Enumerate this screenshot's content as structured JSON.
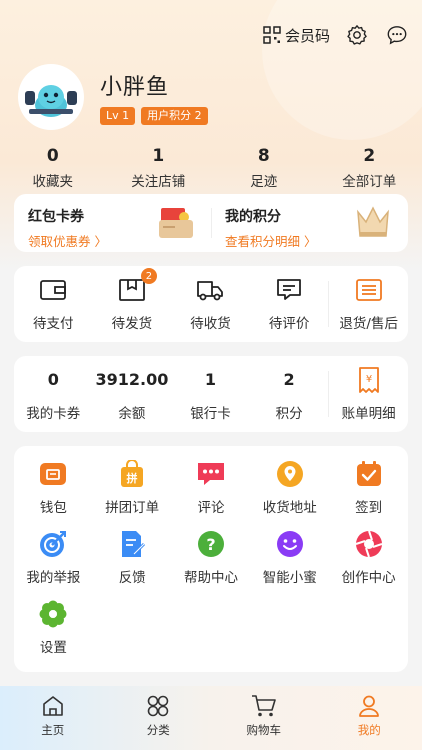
{
  "header": {
    "member_code": "会员码"
  },
  "profile": {
    "username": "小胖鱼",
    "level": "Lv 1",
    "points_badge": "用户积分 2"
  },
  "stats": [
    {
      "value": "0",
      "label": "收藏夹"
    },
    {
      "value": "1",
      "label": "关注店铺"
    },
    {
      "value": "8",
      "label": "足迹"
    },
    {
      "value": "2",
      "label": "全部订单"
    }
  ],
  "promo": {
    "left": {
      "title": "红包卡券",
      "link": "领取优惠券 〉"
    },
    "right": {
      "title": "我的积分",
      "link": "查看积分明细 〉"
    }
  },
  "orders": [
    {
      "label": "待支付",
      "icon": "wallet-icon"
    },
    {
      "label": "待发货",
      "icon": "package-icon",
      "badge": "2"
    },
    {
      "label": "待收货",
      "icon": "truck-icon"
    },
    {
      "label": "待评价",
      "icon": "comment-icon"
    },
    {
      "label": "退货/售后",
      "icon": "refund-icon"
    }
  ],
  "wallet": [
    {
      "value": "0",
      "label": "我的卡券"
    },
    {
      "value": "3912.00",
      "label": "余额"
    },
    {
      "value": "1",
      "label": "银行卡"
    },
    {
      "value": "2",
      "label": "积分"
    },
    {
      "label": "账单明细",
      "icon": "bill-icon"
    }
  ],
  "tools": [
    {
      "label": "钱包",
      "icon": "wallet-orange-icon",
      "color": "#f07a22"
    },
    {
      "label": "拼团订单",
      "icon": "group-bag-icon",
      "color": "#f5a623"
    },
    {
      "label": "评论",
      "icon": "chat-icon",
      "color": "#ef3b57"
    },
    {
      "label": "收货地址",
      "icon": "location-icon",
      "color": "#f5a623"
    },
    {
      "label": "签到",
      "icon": "calendar-check-icon",
      "color": "#f07a22"
    },
    {
      "label": "我的举报",
      "icon": "target-icon",
      "color": "#3b8cf5"
    },
    {
      "label": "反馈",
      "icon": "feedback-icon",
      "color": "#3b8cf5"
    },
    {
      "label": "帮助中心",
      "icon": "help-icon",
      "color": "#4caf3b"
    },
    {
      "label": "智能小蜜",
      "icon": "smile-icon",
      "color": "#8a3bf5"
    },
    {
      "label": "创作中心",
      "icon": "aperture-icon",
      "color": "#ef3b57"
    },
    {
      "label": "设置",
      "icon": "gear-flower-icon",
      "color": "#5cb531"
    }
  ],
  "tabbar": [
    {
      "label": "主页",
      "icon": "home-icon"
    },
    {
      "label": "分类",
      "icon": "category-icon"
    },
    {
      "label": "购物车",
      "icon": "cart-icon"
    },
    {
      "label": "我的",
      "icon": "user-icon",
      "active": true
    }
  ],
  "colors": {
    "accent": "#f07a22"
  }
}
